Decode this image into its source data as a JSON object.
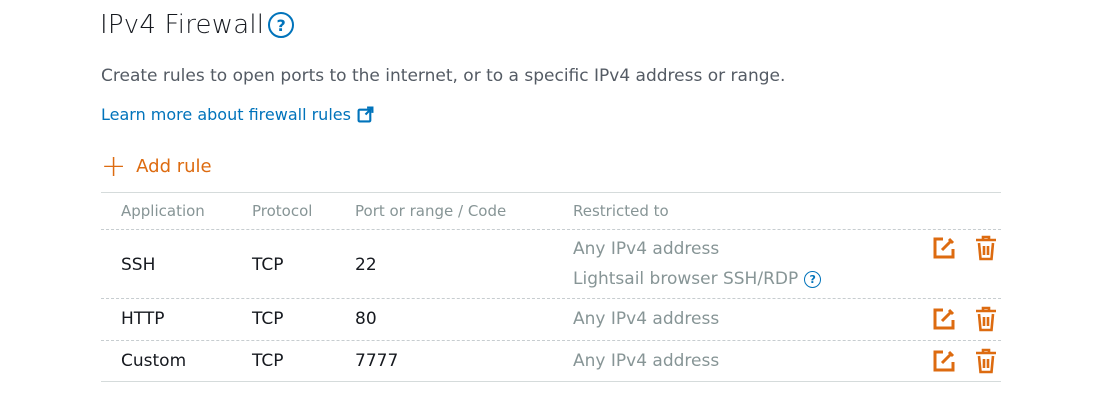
{
  "header": {
    "title": "IPv4 Firewall",
    "help_icon": "?",
    "description": "Create rules to open ports to the internet, or to a specific IPv4 address or range.",
    "learn_more": "Learn more about firewall rules"
  },
  "add_rule": {
    "plus": "+",
    "label": "Add rule"
  },
  "table": {
    "columns": [
      "Application",
      "Protocol",
      "Port or range / Code",
      "Restricted to"
    ],
    "rows": [
      {
        "application": "SSH",
        "protocol": "TCP",
        "port": "22",
        "restricted": "Any IPv4 address",
        "restricted_extra": "Lightsail browser SSH/RDP",
        "restricted_extra_help": "?"
      },
      {
        "application": "HTTP",
        "protocol": "TCP",
        "port": "80",
        "restricted": "Any IPv4 address"
      },
      {
        "application": "Custom",
        "protocol": "TCP",
        "port": "7777",
        "restricted": "Any IPv4 address"
      }
    ]
  },
  "colors": {
    "accent": "#dd6b10",
    "link": "#0073bb",
    "muted": "#879596"
  },
  "icons": {
    "edit": "edit-icon",
    "delete": "trash-icon",
    "external": "external-link-icon",
    "help": "help-icon"
  }
}
